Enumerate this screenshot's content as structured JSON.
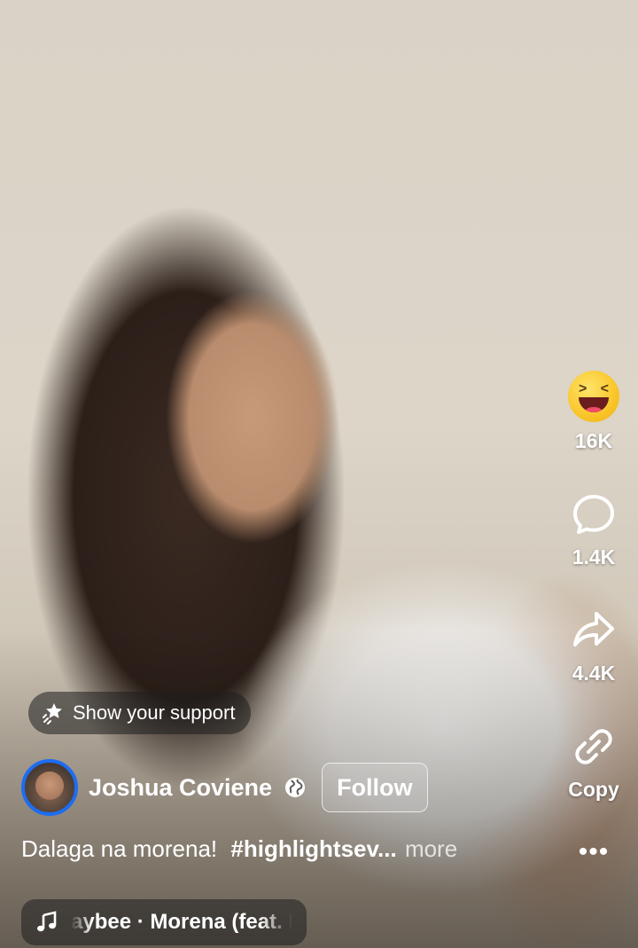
{
  "video": {
    "watermark_text": ""
  },
  "actions": {
    "reaction": {
      "icon": "laughing-emoji-icon",
      "count": "16K"
    },
    "comment": {
      "icon": "comment-icon",
      "count": "1.4K"
    },
    "share": {
      "icon": "share-icon",
      "count": "4.4K"
    },
    "copy": {
      "icon": "link-icon",
      "label": "Copy"
    },
    "more": {
      "icon": "more-dots-icon",
      "label": "•••"
    }
  },
  "support": {
    "label": "Show your support",
    "icon": "sparkle-star-icon"
  },
  "author": {
    "name": "Joshua Coviene",
    "privacy_icon": "globe-icon",
    "follow_label": "Follow",
    "avatar_ring_color": "#1d6df2"
  },
  "caption": {
    "text": "Dalaga na morena!",
    "hashtag": "#highlightsev...",
    "more_label": "more"
  },
  "music": {
    "icon": "music-note-icon",
    "text": "aybee · Morena (feat. I"
  }
}
